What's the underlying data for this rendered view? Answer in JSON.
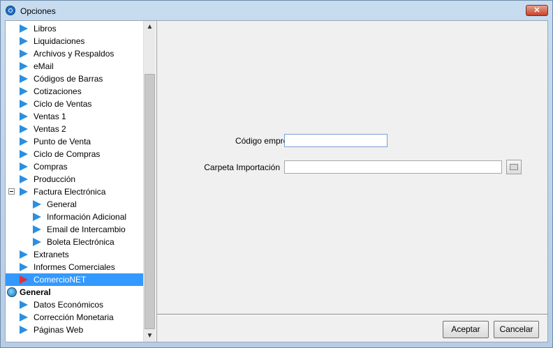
{
  "window": {
    "title": "Opciones",
    "close_label": "✕"
  },
  "tree": {
    "items": [
      {
        "label": "Libros",
        "level": 1,
        "icon": "arrow-right-icon"
      },
      {
        "label": "Liquidaciones",
        "level": 1,
        "icon": "arrow-right-icon"
      },
      {
        "label": "Archivos y Respaldos",
        "level": 1,
        "icon": "arrow-right-icon"
      },
      {
        "label": "eMail",
        "level": 1,
        "icon": "arrow-right-icon"
      },
      {
        "label": "Códigos de Barras",
        "level": 1,
        "icon": "arrow-right-icon"
      },
      {
        "label": "Cotizaciones",
        "level": 1,
        "icon": "arrow-right-icon"
      },
      {
        "label": "Ciclo de Ventas",
        "level": 1,
        "icon": "arrow-right-icon"
      },
      {
        "label": "Ventas 1",
        "level": 1,
        "icon": "arrow-right-icon"
      },
      {
        "label": "Ventas 2",
        "level": 1,
        "icon": "arrow-right-icon"
      },
      {
        "label": "Punto de Venta",
        "level": 1,
        "icon": "arrow-right-icon"
      },
      {
        "label": "Ciclo de Compras",
        "level": 1,
        "icon": "arrow-right-icon"
      },
      {
        "label": "Compras",
        "level": 1,
        "icon": "arrow-right-icon"
      },
      {
        "label": "Producción",
        "level": 1,
        "icon": "arrow-right-icon"
      },
      {
        "label": "Factura Electrónica",
        "level": 1,
        "icon": "arrow-right-icon",
        "expanded": true
      },
      {
        "label": "General",
        "level": 2,
        "icon": "arrow-right-icon"
      },
      {
        "label": "Información Adicional",
        "level": 2,
        "icon": "arrow-right-icon"
      },
      {
        "label": "Email de Intercambio",
        "level": 2,
        "icon": "arrow-right-icon"
      },
      {
        "label": "Boleta Electrónica",
        "level": 2,
        "icon": "arrow-right-icon"
      },
      {
        "label": "Extranets",
        "level": 1,
        "icon": "arrow-right-icon"
      },
      {
        "label": "Informes Comerciales",
        "level": 1,
        "icon": "arrow-right-icon"
      },
      {
        "label": "ComercioNET",
        "level": 1,
        "icon": "arrow-right-icon",
        "selected": true
      },
      {
        "label": "General",
        "level": 0,
        "icon": "globe-icon",
        "bold": true
      },
      {
        "label": "Datos Económicos",
        "level": 1,
        "icon": "arrow-right-icon"
      },
      {
        "label": "Corrección Monetaria",
        "level": 1,
        "icon": "arrow-right-icon"
      },
      {
        "label": "Páginas Web",
        "level": 1,
        "icon": "arrow-right-icon"
      }
    ]
  },
  "form": {
    "empresa_label": "Código empresa",
    "empresa_value": "",
    "carpeta_label": "Carpeta Importación",
    "carpeta_value": ""
  },
  "buttons": {
    "ok": "Aceptar",
    "cancel": "Cancelar"
  },
  "colors": {
    "selection": "#3399ff",
    "arrow": "#2b8fe0",
    "arrow_selected": "#e0303a"
  }
}
